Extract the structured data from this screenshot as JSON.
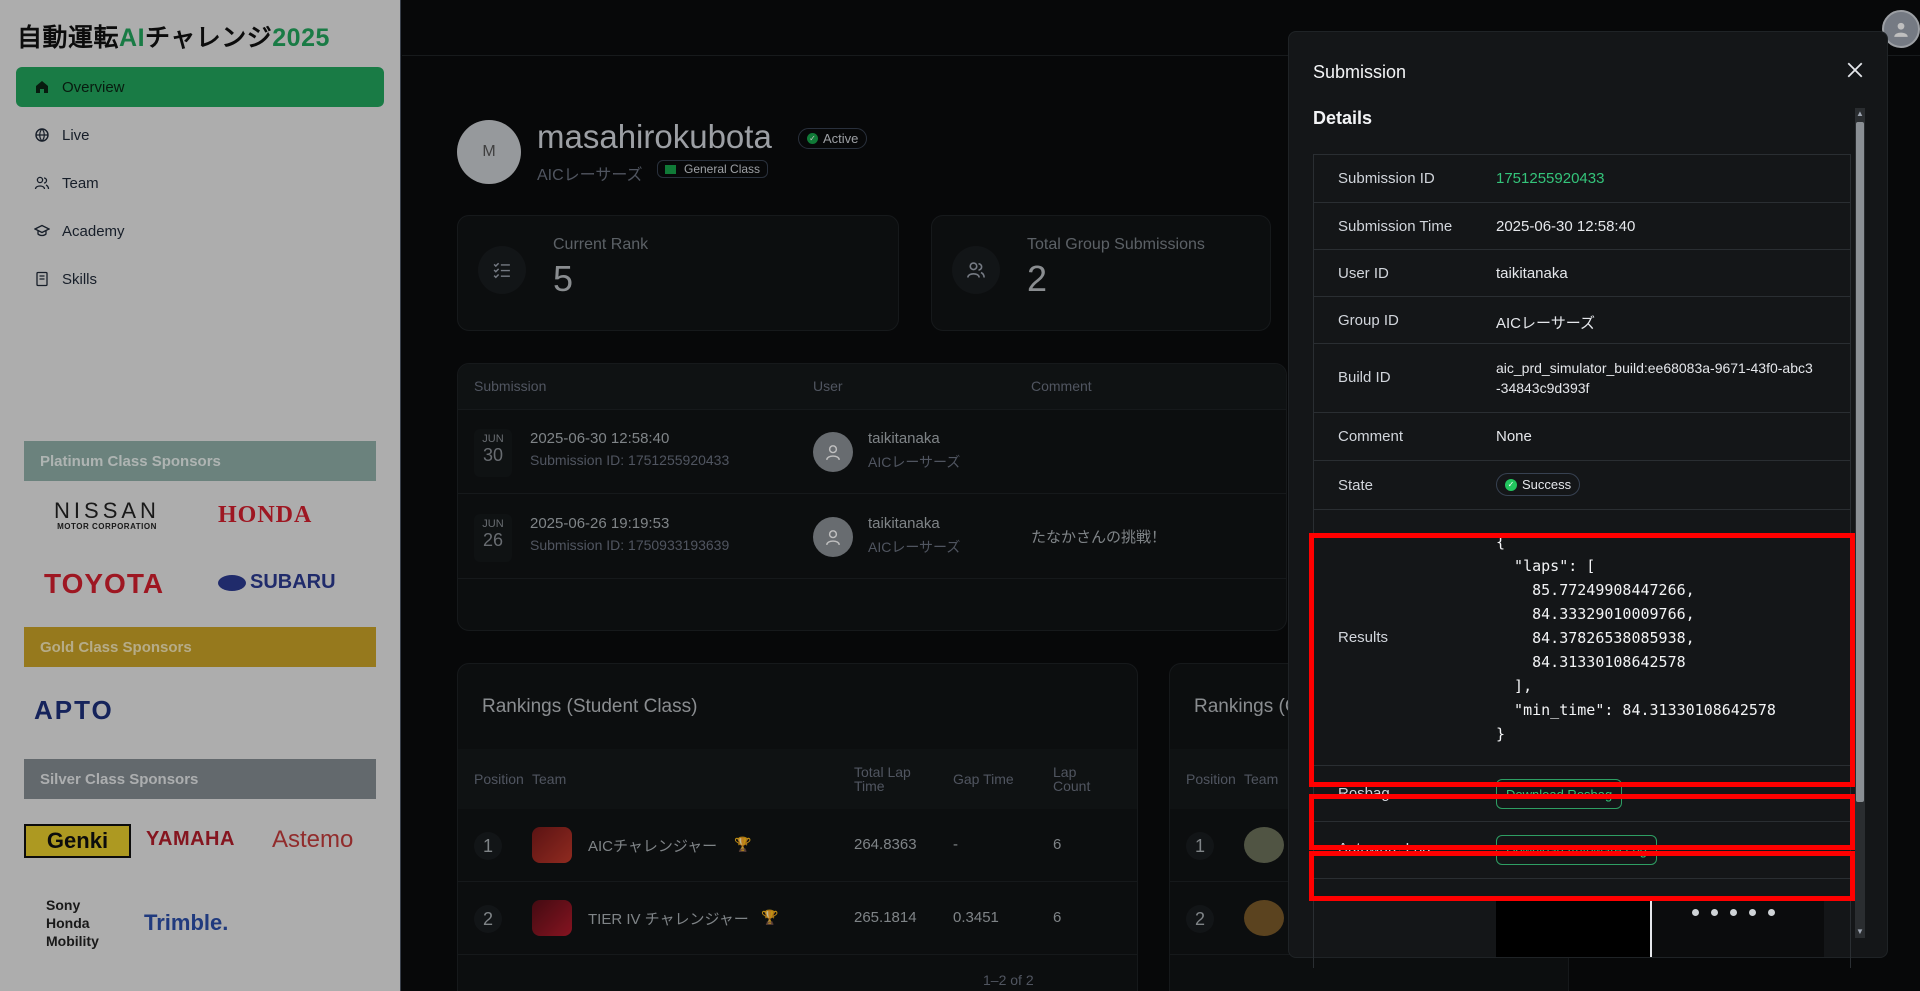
{
  "sidebar": {
    "title_prefix": "自動運転",
    "title_ai": "AI",
    "title_mid": "チャレンジ",
    "title_year": "2025",
    "items": [
      {
        "label": "Overview",
        "icon": "home-icon"
      },
      {
        "label": "Live",
        "icon": "globe-icon"
      },
      {
        "label": "Team",
        "icon": "users-icon"
      },
      {
        "label": "Academy",
        "icon": "graduation-cap-icon"
      },
      {
        "label": "Skills",
        "icon": "book-icon"
      }
    ],
    "sponsors": {
      "platinum_label": "Platinum Class Sponsors",
      "gold_label": "Gold Class Sponsors",
      "silver_label": "Silver Class Sponsors"
    }
  },
  "profile": {
    "initial": "M",
    "name": "masahirokubota",
    "status": "Active",
    "team": "AICレーサーズ",
    "class": "General Class"
  },
  "stats": [
    {
      "label": "Current Rank",
      "value": "5"
    },
    {
      "label": "Total Group Submissions",
      "value": "2"
    }
  ],
  "submissions": {
    "headers": [
      "Submission",
      "User",
      "Comment"
    ],
    "rows": [
      {
        "month": "JUN",
        "day": "30",
        "datetime": "2025-06-30 12:58:40",
        "sub_id": "Submission ID: 1751255920433",
        "user": "taikitanaka",
        "team": "AICレーサーズ",
        "comment": ""
      },
      {
        "month": "JUN",
        "day": "26",
        "datetime": "2025-06-26 19:19:53",
        "sub_id": "Submission ID: 1750933193639",
        "user": "taikitanaka",
        "team": "AICレーサーズ",
        "comment": "たなかさんの挑戦！"
      }
    ]
  },
  "rankings_student": {
    "title": "Rankings (Student Class)",
    "headers": {
      "position": "Position",
      "team": "Team",
      "total": "Total Lap Time",
      "gap": "Gap Time",
      "laps": "Lap Count"
    },
    "rows": [
      {
        "pos": "1",
        "team": "AICチャレンジャー",
        "total": "264.8363",
        "gap": "-",
        "laps": "6"
      },
      {
        "pos": "2",
        "team": "TIER IV チャレンジャー",
        "total": "265.1814",
        "gap": "0.3451",
        "laps": "6"
      }
    ],
    "pager": "1–2 of 2"
  },
  "rankings_general": {
    "title": "Rankings (G",
    "headers": {
      "position": "Position",
      "team": "Team"
    },
    "rows": [
      {
        "pos": "1"
      },
      {
        "pos": "2"
      }
    ]
  },
  "modal": {
    "title": "Submission",
    "section": "Details",
    "rows": {
      "submission_id": {
        "label": "Submission ID",
        "value": "1751255920433"
      },
      "submission_time": {
        "label": "Submission Time",
        "value": "2025-06-30 12:58:40"
      },
      "user_id": {
        "label": "User ID",
        "value": "taikitanaka"
      },
      "group_id": {
        "label": "Group ID",
        "value": "AICレーサーズ"
      },
      "build_id": {
        "label": "Build ID",
        "value": "aic_prd_simulator_build:ee68083a-9671-43f0-abc3-34843c9d393f"
      },
      "comment": {
        "label": "Comment",
        "value": "None"
      },
      "state": {
        "label": "State",
        "value": "Success"
      },
      "results": {
        "label": "Results",
        "value": "{\n  \"laps\": [\n    85.77249908447266,\n    84.33329010009766,\n    84.37826538085938,\n    84.31330108642578\n  ],\n  \"min_time\": 84.31330108642578\n}"
      },
      "rosbag": {
        "label": "Rosbag",
        "button": "Download Rosbag"
      },
      "autoware_log": {
        "label": "Autoware Log",
        "button": "Download Autoware Log"
      }
    }
  },
  "colors": {
    "accent": "#22a45c",
    "highlight": "#ff0000"
  }
}
